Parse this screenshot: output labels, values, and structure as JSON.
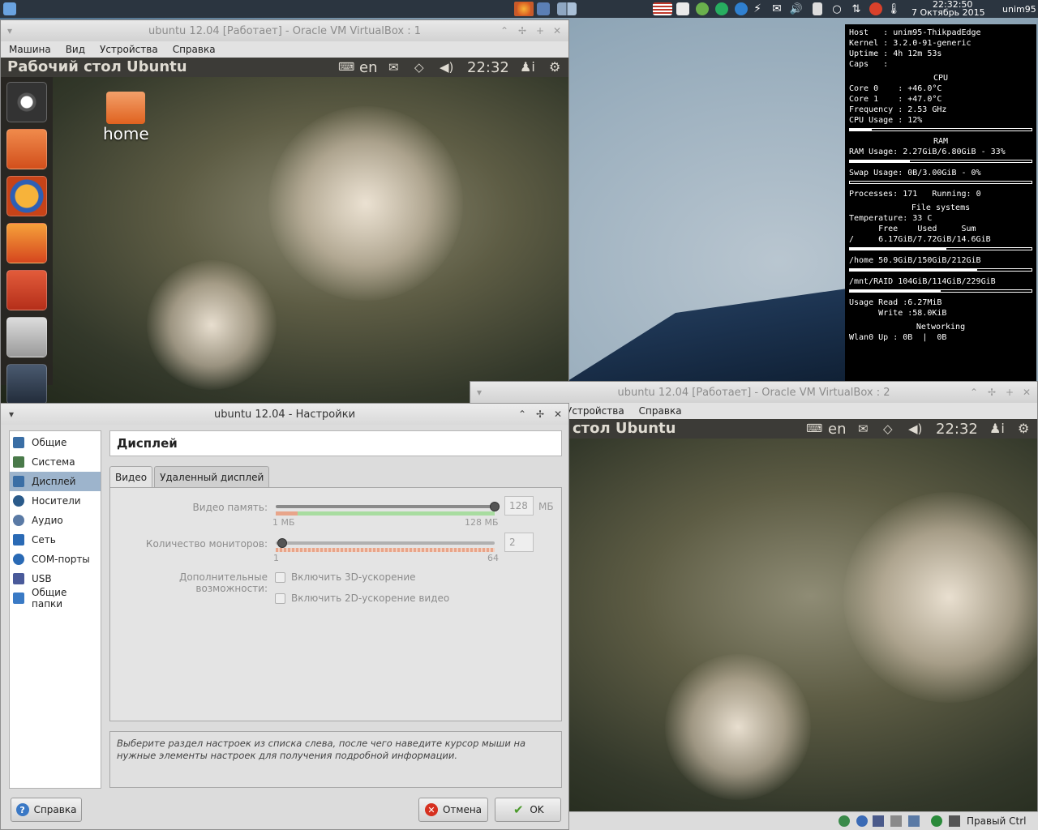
{
  "host_panel": {
    "time": "22:32:50",
    "date": "7 Октябрь 2015",
    "user": "unim95"
  },
  "conky": {
    "host_label": "Host",
    "host_value": "unim95-ThikpadEdge",
    "kernel_label": "Kernel",
    "kernel_value": "3.2.0-91-generic",
    "uptime_label": "Uptime",
    "uptime_value": "4h 12m 53s",
    "caps_label": "Caps",
    "cpu_header": "CPU",
    "core0_label": "Core 0",
    "core0_value": "+46.0°C",
    "core1_label": "Core 1",
    "core1_value": "+47.0°C",
    "freq_label": "Frequency",
    "freq_value": "2.53 GHz",
    "cpu_usage_label": "CPU Usage",
    "cpu_usage_value": "12%",
    "cpu_usage_fraction": 0.12,
    "ram_header": "RAM",
    "ram_label": "RAM Usage:",
    "ram_value": "2.27GiB/6.80GiB - 33%",
    "ram_fraction": 0.33,
    "swap_label": "Swap Usage:",
    "swap_value": "0B/3.00GiB - 0%",
    "swap_fraction": 0.0,
    "proc_label": "Processes:",
    "proc_value": "171",
    "running_label": "Running:",
    "running_value": "0",
    "fs_header": "File systems",
    "temp_label": "Temperature:",
    "temp_value": "33 C",
    "fs_col_free": "Free",
    "fs_col_used": "Used",
    "fs_col_sum": "Sum",
    "fs_root_name": "/",
    "fs_root_value": "6.17GiB/7.72GiB/14.6GiB",
    "fs_root_fraction": 0.53,
    "fs_home_name": "/home",
    "fs_home_value": "50.9GiB/150GiB/212GiB",
    "fs_home_fraction": 0.7,
    "fs_raid_name": "/mnt/RAID",
    "fs_raid_value": "104GiB/114GiB/229GiB",
    "fs_raid_fraction": 0.5,
    "io_read_label": "Usage Read",
    "io_read_value": ":6.27MiB",
    "io_write_label": "Write",
    "io_write_value": ":58.0KiB",
    "net_header": "Networking",
    "wlan_label": "Wlan0 Up",
    "wlan_value": ": 0B  |  0B"
  },
  "vm1": {
    "title": "ubuntu 12.04 [Работает] - Oracle VM VirtualBox : 1",
    "menu": [
      "Машина",
      "Вид",
      "Устройства",
      "Справка"
    ],
    "desktop_title": "Рабочий стол Ubuntu",
    "lang": "en",
    "clock": "22:32",
    "home_icon_label": "home"
  },
  "vm2": {
    "title": "ubuntu 12.04 [Работает] - Oracle VM VirtualBox : 2",
    "menu": [
      "Устройства",
      "Справка"
    ],
    "desktop_title": "стол Ubuntu",
    "lang": "en",
    "clock": "22:32",
    "host_key": "Правый Ctrl"
  },
  "settings": {
    "title": "ubuntu 12.04 - Настройки",
    "sidebar": [
      {
        "label": "Общие",
        "icon": "monitor-icon",
        "color": "#3a6ea5"
      },
      {
        "label": "Система",
        "icon": "chip-icon",
        "color": "#4a7a4a"
      },
      {
        "label": "Дисплей",
        "icon": "display-icon",
        "color": "#3a6ea5"
      },
      {
        "label": "Носители",
        "icon": "disc-icon",
        "color": "#2a5a8a"
      },
      {
        "label": "Аудио",
        "icon": "speaker-icon",
        "color": "#5a7aa5"
      },
      {
        "label": "Сеть",
        "icon": "network-icon",
        "color": "#2a6ab5"
      },
      {
        "label": "COM-порты",
        "icon": "serial-icon",
        "color": "#2a6ab5"
      },
      {
        "label": "USB",
        "icon": "usb-icon",
        "color": "#4a5a9a"
      },
      {
        "label": "Общие папки",
        "icon": "folder-icon",
        "color": "#3a7ac5"
      }
    ],
    "selected_index": 2,
    "section_title": "Дисплей",
    "tabs": [
      "Видео",
      "Удаленный дисплей"
    ],
    "video_memory_label": "Видео память:",
    "video_memory_value": "128",
    "video_memory_unit": "МБ",
    "video_memory_min": "1 МБ",
    "video_memory_max": "128 МБ",
    "video_memory_fraction": 1.0,
    "monitors_label": "Количество мониторов:",
    "monitors_value": "2",
    "monitors_min": "1",
    "monitors_max": "64",
    "monitors_fraction": 0.0,
    "extra_label": "Дополнительные возможности:",
    "accel3d_label": "Включить 3D-ускорение",
    "accel2d_label": "Включить 2D-ускорение видео",
    "info_text": "Выберите раздел настроек из списка слева, после чего наведите курсор мыши на нужные элементы настроек для получения подробной информации.",
    "help_button": "Справка",
    "cancel_button": "Отмена",
    "ok_button": "OK"
  }
}
